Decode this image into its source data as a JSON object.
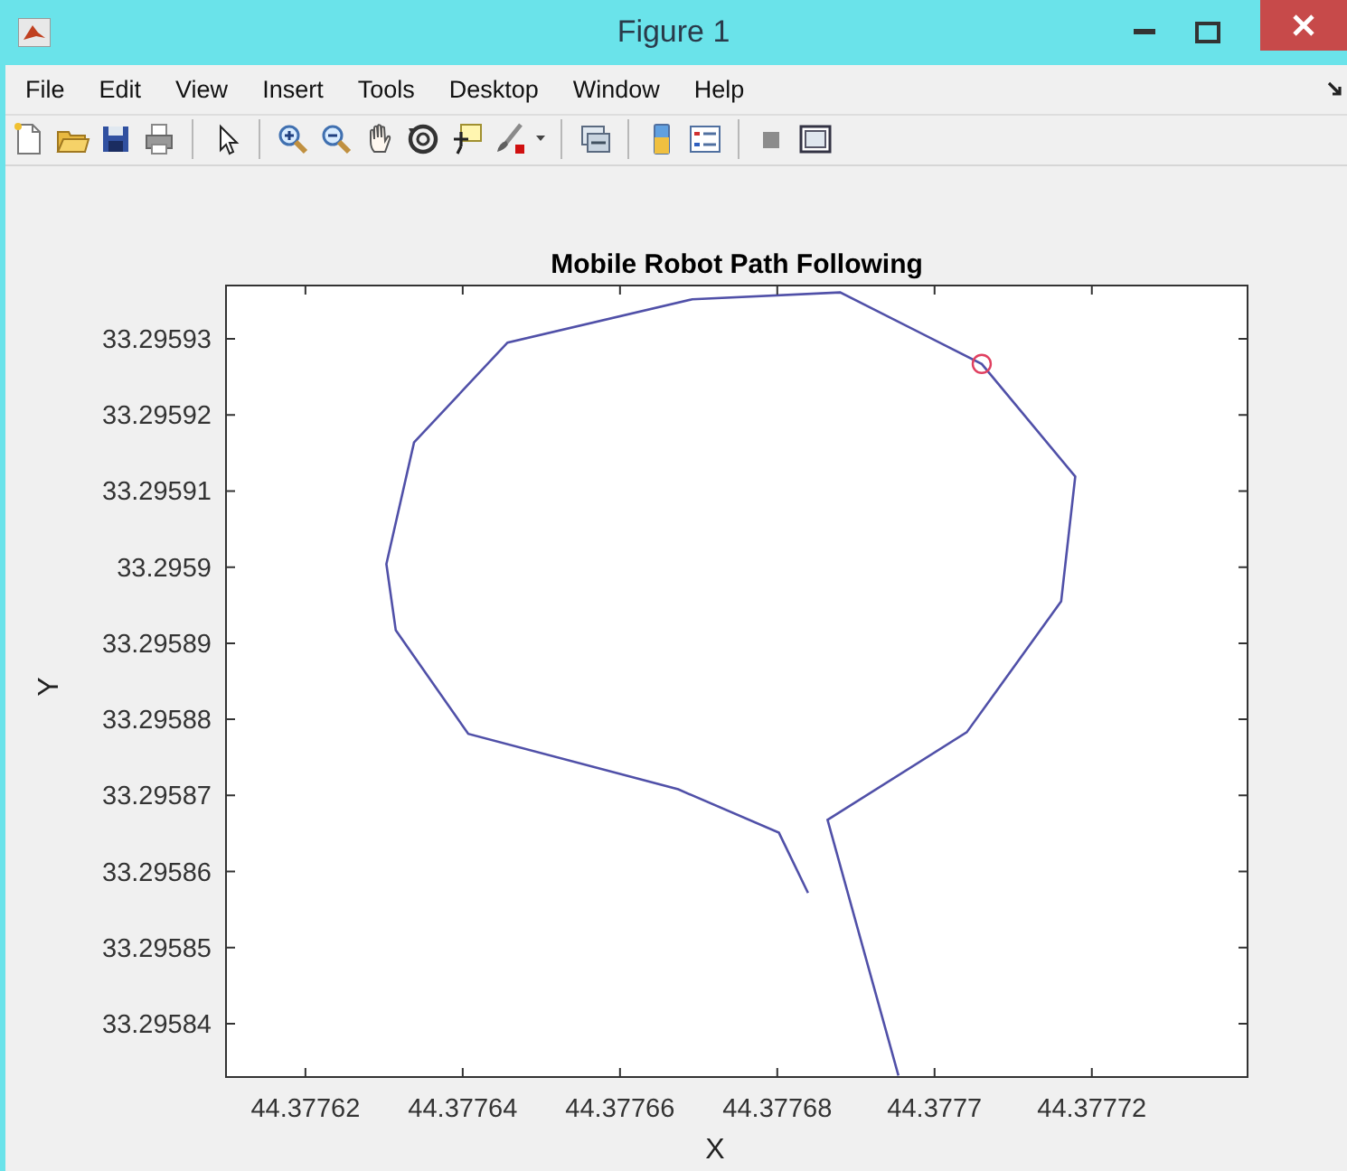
{
  "window": {
    "title": "Figure 1"
  },
  "menu": [
    {
      "label": "File"
    },
    {
      "label": "Edit"
    },
    {
      "label": "View"
    },
    {
      "label": "Insert"
    },
    {
      "label": "Tools"
    },
    {
      "label": "Desktop"
    },
    {
      "label": "Window"
    },
    {
      "label": "Help"
    }
  ],
  "figure": {
    "chart_data": {
      "type": "line",
      "title": "Mobile Robot Path Following",
      "xlabel": "X",
      "ylabel": "Y",
      "x": [
        44.3776839,
        44.3776802,
        44.3776674,
        44.3776407,
        44.3776315,
        44.3776303,
        44.3776338,
        44.3776457,
        44.3776692,
        44.377688,
        44.377706,
        44.3777179,
        44.3777161,
        44.3777041,
        44.3776864,
        44.3776954
      ],
      "series": [
        {
          "color": "#5050a8",
          "values": [
            33.2958572,
            33.2958651,
            33.2958708,
            33.2958781,
            33.2958917,
            33.2959004,
            33.2959164,
            33.2959295,
            33.2959352,
            33.2959361,
            33.2959267,
            33.2959119,
            33.2958955,
            33.2958783,
            33.2958668,
            33.2958332
          ]
        },
        {
          "type": "scatter",
          "color": "#e04060",
          "values": [
            null,
            null,
            null,
            null,
            null,
            null,
            null,
            null,
            null,
            null,
            33.2959267,
            null,
            null,
            null,
            null,
            null
          ]
        }
      ],
      "xlim": [
        44.3776099,
        44.3777398
      ],
      "ylim": [
        33.295833,
        33.295937
      ],
      "xticks": [
        44.37762,
        44.37764,
        44.37766,
        44.37768,
        44.3777,
        44.37772
      ],
      "yticks": [
        33.29584,
        33.29585,
        33.29586,
        33.29587,
        33.29588,
        33.29589,
        33.2959,
        33.29591,
        33.29592,
        33.29593
      ]
    }
  }
}
